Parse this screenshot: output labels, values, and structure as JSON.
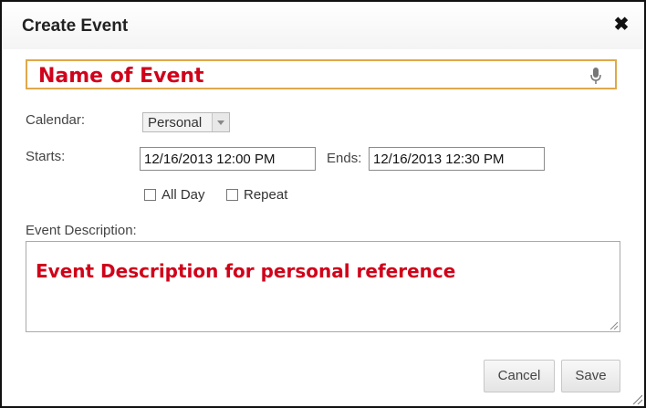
{
  "dialog": {
    "title": "Create Event",
    "close_icon": "close-icon"
  },
  "name_field": {
    "value": "Name of Event",
    "mic_icon": "microphone-icon"
  },
  "calendar": {
    "label": "Calendar:",
    "selected": "Personal"
  },
  "time": {
    "starts_label": "Starts:",
    "starts_value": "12/16/2013 12:00 PM",
    "ends_label": "Ends:",
    "ends_value": "12/16/2013 12:30 PM"
  },
  "options": {
    "all_day_label": "All Day",
    "all_day_checked": false,
    "repeat_label": "Repeat",
    "repeat_checked": false
  },
  "description": {
    "label": "Event Description:",
    "value": "Event Description for personal reference"
  },
  "buttons": {
    "cancel": "Cancel",
    "save": "Save"
  },
  "colors": {
    "accent_border": "#e0a84a",
    "annotation_red": "#d0021b"
  }
}
